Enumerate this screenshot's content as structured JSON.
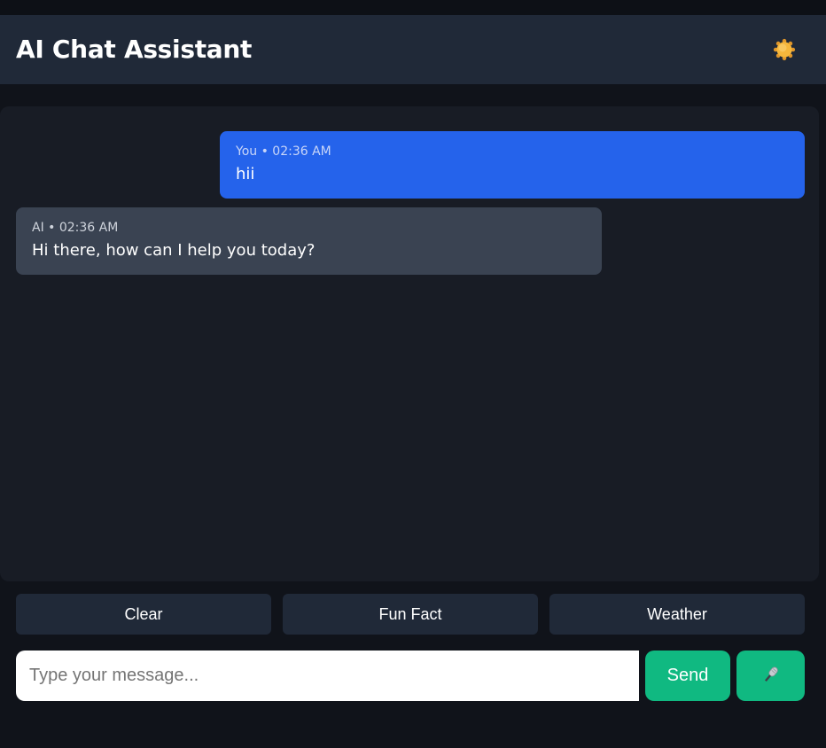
{
  "header": {
    "title": "AI Chat Assistant",
    "theme_icon": "sun-icon"
  },
  "messages": [
    {
      "role": "user",
      "sender": "You",
      "time": "02:36 AM",
      "meta": "You • 02:36 AM",
      "text": "hii"
    },
    {
      "role": "ai",
      "sender": "AI",
      "time": "02:36 AM",
      "meta": "AI • 02:36 AM",
      "text": "Hi there, how can I help you today?"
    }
  ],
  "quick_actions": {
    "clear": "Clear",
    "fun_fact": "Fun Fact",
    "weather": "Weather"
  },
  "composer": {
    "placeholder": "Type your message...",
    "value": "",
    "send_label": "Send",
    "mic_icon": "microphone-icon"
  },
  "colors": {
    "background": "#10131a",
    "header": "#202938",
    "chat_panel": "#181c25",
    "user_bubble": "#2563eb",
    "ai_bubble": "#3a4352",
    "accent_green": "#10b981",
    "sun": "#f5b942"
  }
}
